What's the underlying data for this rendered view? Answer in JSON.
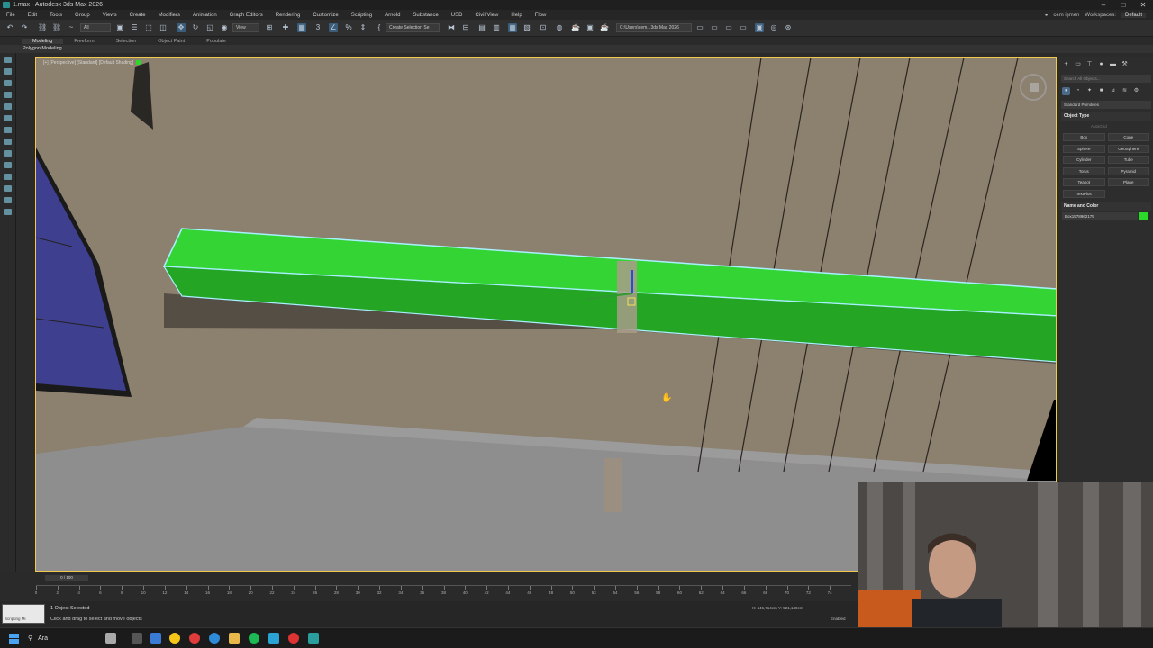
{
  "window": {
    "title": "1.max - Autodesk 3ds Max 2026",
    "controls": [
      "–",
      "□",
      "✕"
    ]
  },
  "menu": {
    "items": [
      "File",
      "Edit",
      "Tools",
      "Group",
      "Views",
      "Create",
      "Modifiers",
      "Animation",
      "Graph Editors",
      "Rendering",
      "Customize",
      "Scripting",
      "Arnold",
      "Substance",
      "USD",
      "Civil View",
      "Help",
      "Flow"
    ],
    "user": "cem işmen",
    "workspaces_label": "Workspaces:",
    "workspace": "Default"
  },
  "toolbar": {
    "filter": "All",
    "refcoord": "View",
    "selection_set": "Create Selection Se",
    "project_path": "C:\\Users\\cem...3ds Max 2026"
  },
  "ribbon": {
    "tabs": [
      "Modeling",
      "Freeform",
      "Selection",
      "Object Paint",
      "Populate"
    ],
    "active_panel": "Polygon Modeling"
  },
  "viewport": {
    "label": "[+] [Perspective] [Standard] [Default Shading]"
  },
  "command_panel": {
    "search_placeholder": "Search All Objects...",
    "category": "Standard Primitives",
    "object_type_title": "Object Type",
    "autogrid": "AutoGrid",
    "objects": [
      "Box",
      "Cone",
      "Sphere",
      "GeoSphere",
      "Cylinder",
      "Tube",
      "Torus",
      "Pyramid",
      "Teapot",
      "Plane",
      "TextPlus"
    ],
    "name_color_title": "Name and Color",
    "object_name": "Box1578962175",
    "object_color": "#2bd92b"
  },
  "timeline": {
    "frame": "0 / 100",
    "ticks": [
      0,
      2,
      4,
      6,
      8,
      10,
      12,
      14,
      16,
      18,
      20,
      22,
      24,
      26,
      28,
      30,
      32,
      34,
      36,
      38,
      40,
      42,
      44,
      46,
      48,
      50,
      52,
      54,
      56,
      58,
      60,
      62,
      64,
      66,
      68,
      70,
      72,
      74
    ]
  },
  "status": {
    "maxscript_label": "Scripting Mi",
    "selected": "1 Object Selected",
    "prompt": "Click and drag to select and move objects",
    "coords": "X: 446,714cm   Y: 521,149cm",
    "enabled": "Enabled"
  },
  "taskbar": {
    "search": "Ara"
  }
}
